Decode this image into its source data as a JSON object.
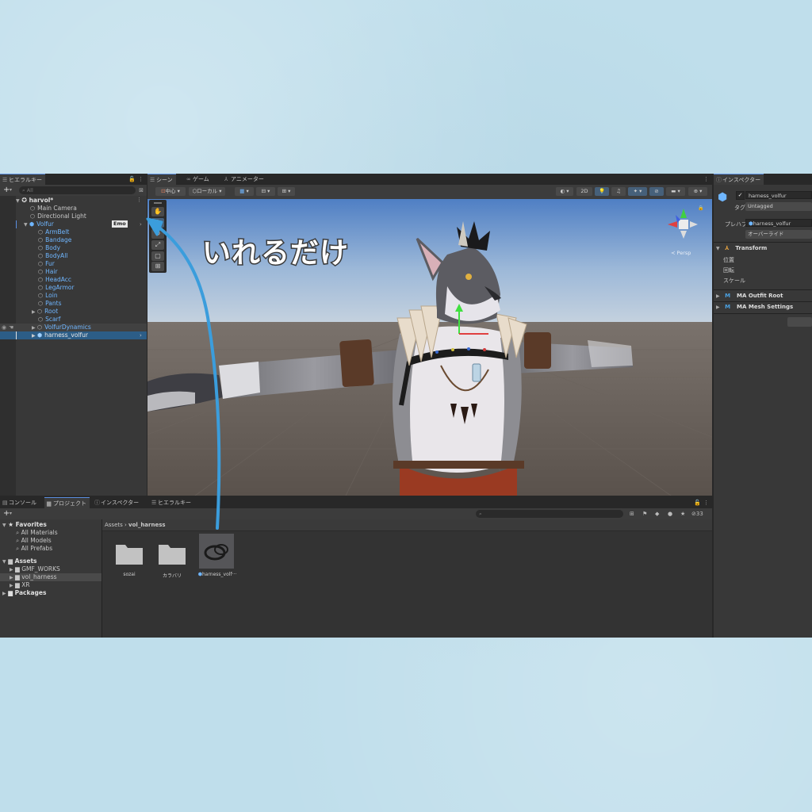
{
  "hierarchy": {
    "tab_label": "ヒエラルキー",
    "search_placeholder": "All",
    "scene_name": "harvol*",
    "items": [
      {
        "label": "Main Camera"
      },
      {
        "label": "Directional Light"
      },
      {
        "label": "Volfur",
        "badge": "Emo"
      },
      {
        "label": "ArmBelt"
      },
      {
        "label": "Bandage"
      },
      {
        "label": "Body"
      },
      {
        "label": "BodyAll"
      },
      {
        "label": "Fur"
      },
      {
        "label": "Hair"
      },
      {
        "label": "HeadAcc"
      },
      {
        "label": "LegArmor"
      },
      {
        "label": "Loin"
      },
      {
        "label": "Pants"
      },
      {
        "label": "Root"
      },
      {
        "label": "Scarf"
      },
      {
        "label": "VolfurDynamics"
      },
      {
        "label": "harness_volfur"
      }
    ]
  },
  "scene_view": {
    "tabs": [
      "シーン",
      "ゲーム",
      "アニメーター"
    ],
    "pivot_label": "中心",
    "space_label": "ローカル",
    "mode_2d": "2D",
    "persp_label": "≺ Persp",
    "annotation": "いれるだけ"
  },
  "inspector": {
    "tab_label": "インスペクター",
    "object_name": "harness_volfur",
    "tag_label": "タグ",
    "tag_value": "Untagged",
    "prefab_label": "プレハブ",
    "prefab_value": "harness_volfur",
    "override_label": "オーバーライド",
    "components": [
      {
        "name": "Transform",
        "fields": [
          "位置",
          "回転",
          "スケール"
        ]
      },
      {
        "name": "MA Outfit Root"
      },
      {
        "name": "MA Mesh Settings"
      }
    ]
  },
  "bottom": {
    "tabs": [
      "コンソール",
      "プロジェクト",
      "インスペクター",
      "ヒエラルキー"
    ],
    "favorites_label": "Favorites",
    "favorites": [
      "All Materials",
      "All Models",
      "All Prefabs"
    ],
    "assets_label": "Assets",
    "asset_folders": [
      "GMF_WORKS",
      "vol_harness",
      "XR"
    ],
    "packages_label": "Packages",
    "breadcrumb_root": "Assets",
    "breadcrumb_current": "vol_harness",
    "hidden_count": "33",
    "grid_items": [
      "sozai",
      "カラバリ",
      "harness_volf···"
    ]
  }
}
